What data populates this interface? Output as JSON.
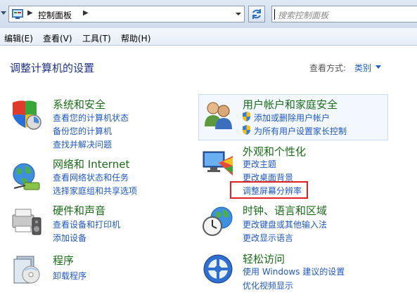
{
  "address": {
    "breadcrumb": "控制面板",
    "search_placeholder": "搜索控制面板"
  },
  "menu": [
    "编辑(E)",
    "查看(V)",
    "工具(T)",
    "帮助(H)"
  ],
  "page": {
    "title": "调整计算机的设置",
    "view_label": "查看方式:",
    "view_value": "类别"
  },
  "left_categories": [
    {
      "title": "系统和安全",
      "links": [
        "查看您的计算机状态",
        "备份您的计算机",
        "查找并解决问题"
      ]
    },
    {
      "title": "网络和 Internet",
      "links": [
        "查看网络状态和任务",
        "选择家庭组和共享选项"
      ]
    },
    {
      "title": "硬件和声音",
      "links": [
        "查看设备和打印机",
        "添加设备"
      ]
    },
    {
      "title": "程序",
      "links": [
        "卸载程序"
      ]
    }
  ],
  "right_categories": [
    {
      "title": "用户帐户和家庭安全",
      "links": [
        "添加或删除用户帐户",
        "为所有用户设置家长控制"
      ]
    },
    {
      "title": "外观和个性化",
      "links": [
        "更改主题",
        "更改桌面背景",
        "调整屏幕分辨率"
      ]
    },
    {
      "title": "时钟、语言和区域",
      "links": [
        "更改键盘或其他输入法",
        "更改显示语言"
      ]
    },
    {
      "title": "轻松访问",
      "links": [
        "使用 Windows 建议的设置",
        "优化视频显示"
      ]
    }
  ],
  "colors": {
    "title_blue": "#1e3287",
    "category_green": "#1a6b1a",
    "link_blue": "#2058c2",
    "highlight_red": "#e02020"
  }
}
